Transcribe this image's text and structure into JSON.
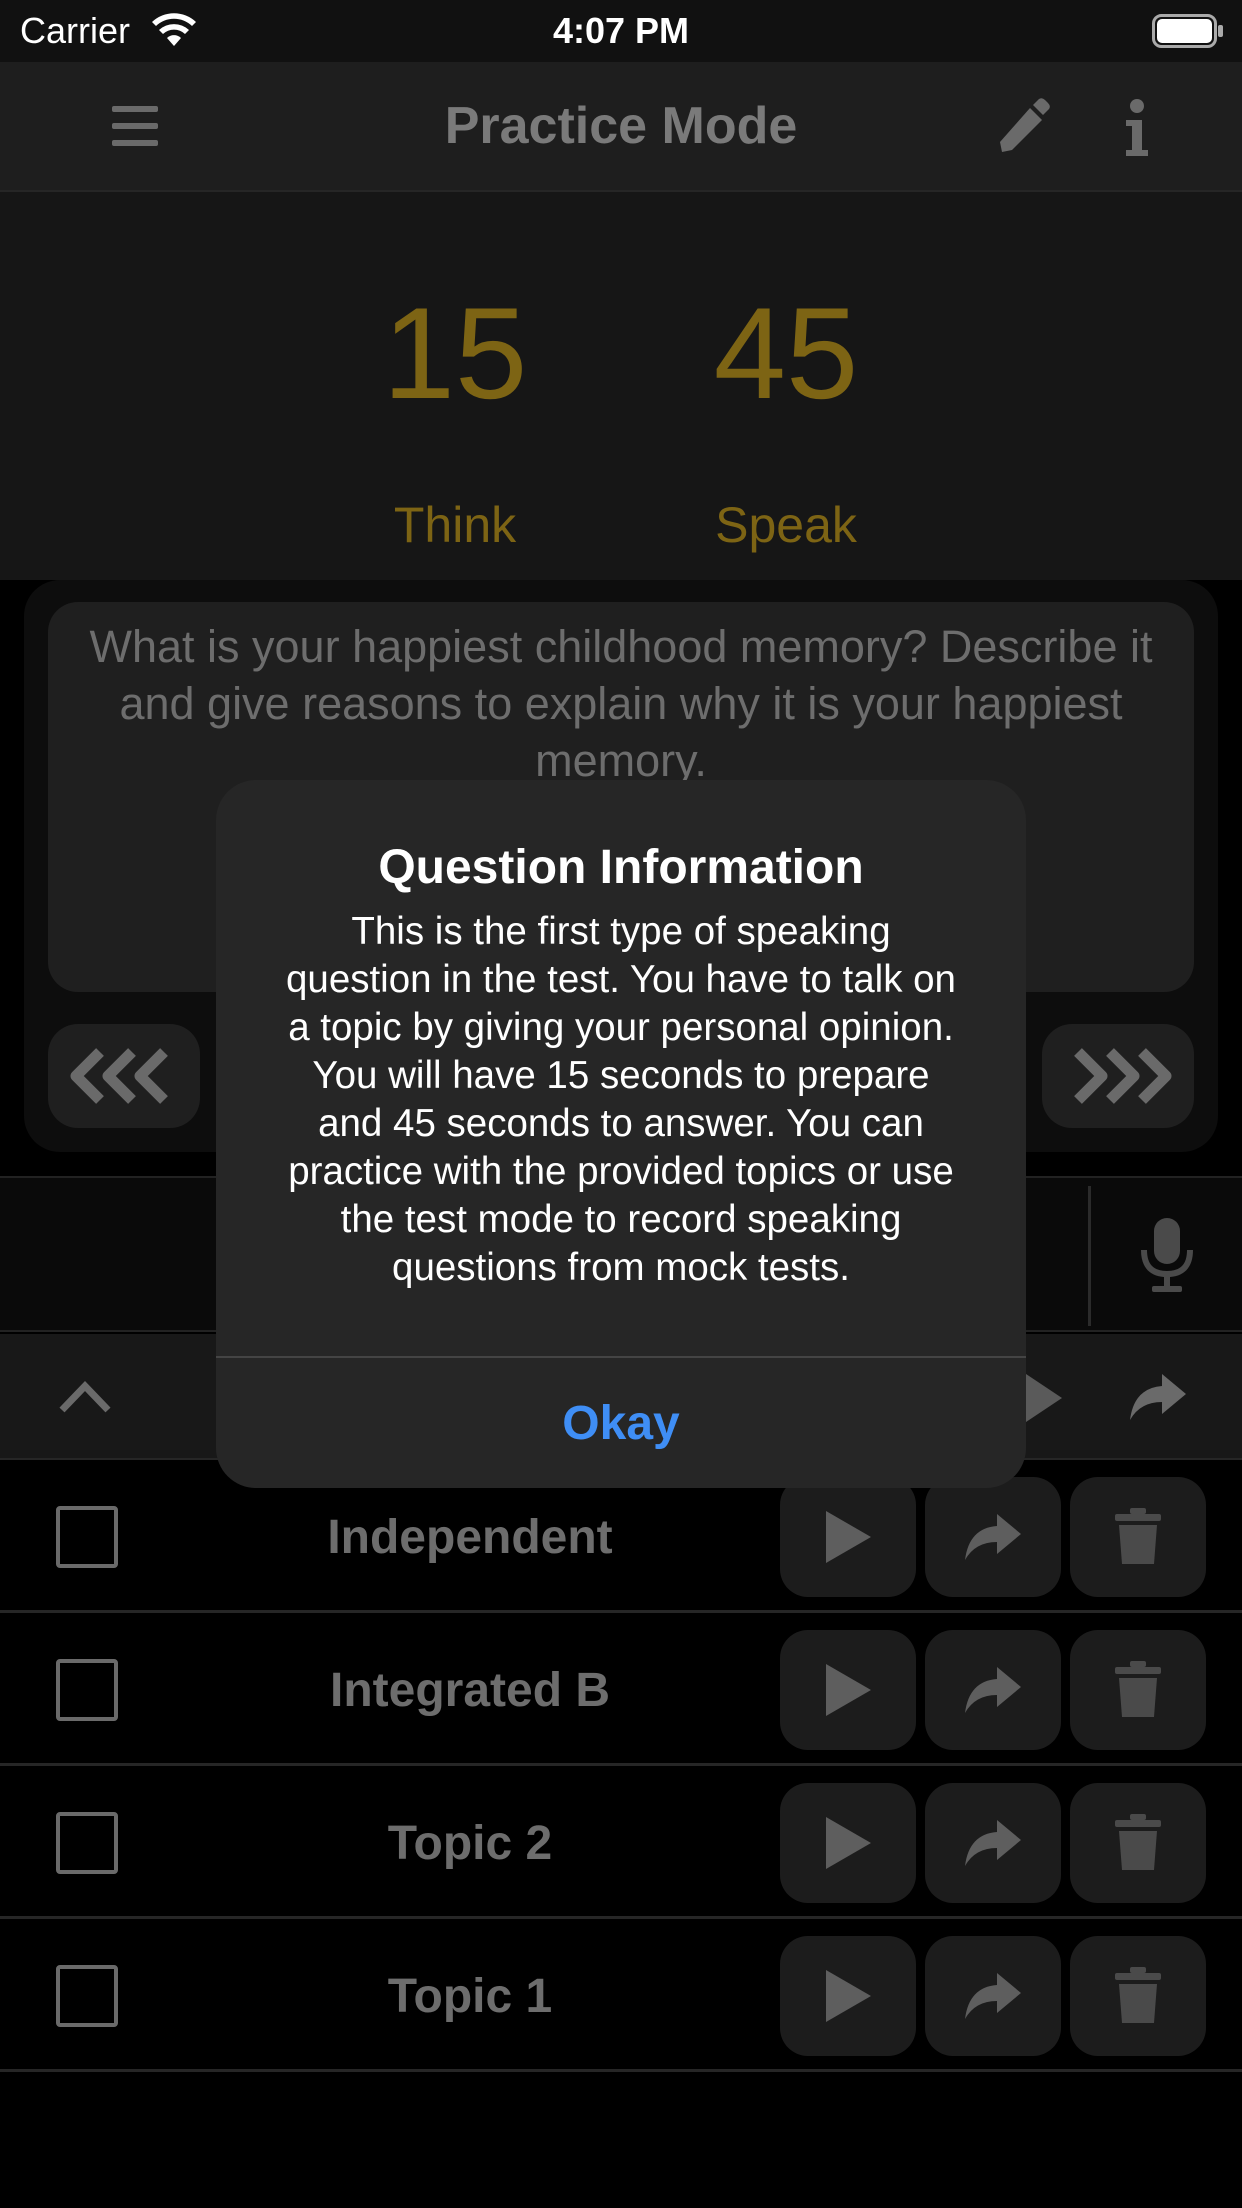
{
  "status_bar": {
    "carrier": "Carrier",
    "time": "4:07 PM"
  },
  "nav": {
    "title": "Practice Mode",
    "icons": [
      "menu-icon",
      "pencil-icon",
      "info-icon"
    ]
  },
  "timers": {
    "think_value": "15",
    "think_label": "Think",
    "speak_value": "45",
    "speak_label": "Speak",
    "color": "#7d6414"
  },
  "question": {
    "text": "What is your happiest childhood memory? Describe it and give reasons to explain why it is your happiest memory."
  },
  "recordings": [
    {
      "label": "Independent"
    },
    {
      "label": "Integrated B"
    },
    {
      "label": "Topic 2"
    },
    {
      "label": "Topic 1"
    }
  ],
  "alert": {
    "title": "Question Information",
    "body": "This is the first type of speaking question in the test. You have to talk on a topic by giving your personal opinion. You will have 15 seconds to prepare and 45 seconds to answer. You can practice with the provided topics or use the test mode to record speaking questions from mock tests.",
    "button_label": "Okay",
    "button_color": "#3f8ef5"
  }
}
